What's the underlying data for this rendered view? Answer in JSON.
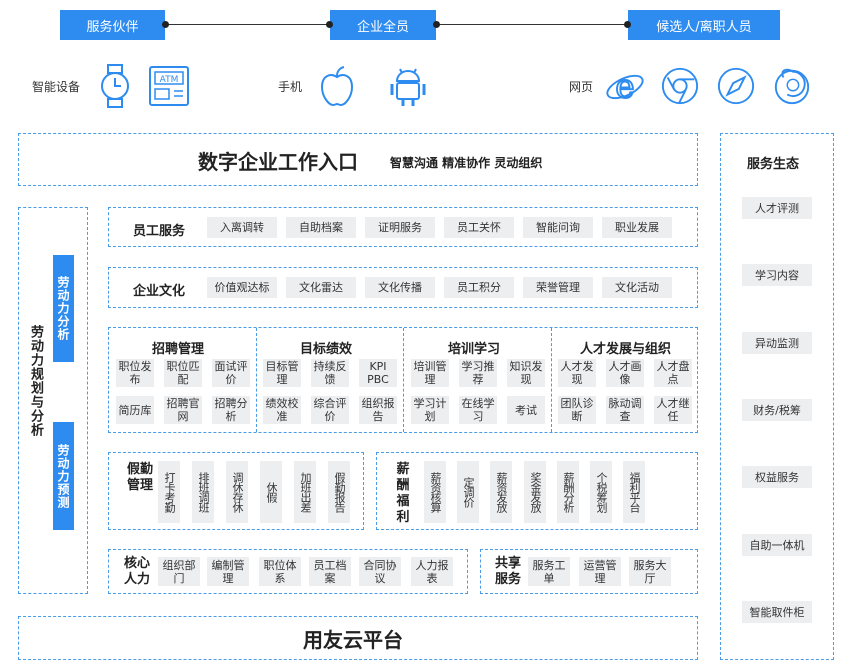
{
  "roles": [
    "服务伙伴",
    "企业全员",
    "候选人/离职人员"
  ],
  "devices": {
    "smart_label": "智能设备",
    "phone_label": "手机",
    "web_label": "网页",
    "atm_text": "ATM"
  },
  "portal": {
    "title": "数字企业工作入口",
    "subtitle": "智慧沟通  精准协作  灵动组织"
  },
  "left_panel": {
    "title": "劳动力规划与分析",
    "bar1": "劳动力分析",
    "bar2": "劳动力预测"
  },
  "employee_service": {
    "title": "员工服务",
    "items": [
      "入离调转",
      "自助档案",
      "证明服务",
      "员工关怀",
      "智能问询",
      "职业发展"
    ]
  },
  "culture": {
    "title": "企业文化",
    "items": [
      "价值观达标",
      "文化雷达",
      "文化传播",
      "员工积分",
      "荣誉管理",
      "文化活动"
    ]
  },
  "modules": [
    {
      "title": "招聘管理",
      "items": [
        "职位发布",
        "职位匹配",
        "面试评价",
        "简历库",
        "招聘官网",
        "招聘分析"
      ]
    },
    {
      "title": "目标绩效",
      "items": [
        "目标管理",
        "持续反馈",
        "KPI PBC",
        "绩效校准",
        "综合评价",
        "组织报告"
      ]
    },
    {
      "title": "培训学习",
      "items": [
        "培训管理",
        "学习推荐",
        "知识发现",
        "学习计划",
        "在线学习",
        "考试"
      ]
    },
    {
      "title": "人才发展与组织",
      "items": [
        "人才发现",
        "人才画像",
        "人才盘点",
        "团队诊断",
        "脉动调查",
        "人才继任"
      ]
    }
  ],
  "attendance": {
    "title": "假勤管理",
    "items": [
      "打卡考勤",
      "排班调班",
      "调休存休",
      "休假",
      "加班出差",
      "假勤报告"
    ]
  },
  "payroll": {
    "title": "薪酬福利",
    "items": [
      "薪资核算",
      "定调价",
      "薪资发放",
      "奖金发放",
      "薪酬分析",
      "个税筹划",
      "福利平台"
    ]
  },
  "core_hr": {
    "title": "核心人力",
    "items": [
      "组织部门",
      "编制管理",
      "职位体系",
      "员工档案",
      "合同协议",
      "人力报表"
    ]
  },
  "shared": {
    "title": "共享服务",
    "items": [
      "服务工单",
      "运营管理",
      "服务大厅"
    ]
  },
  "platform": {
    "title": "用友云平台"
  },
  "ecosystem": {
    "title": "服务生态",
    "items": [
      "人才评测",
      "学习内容",
      "异动监测",
      "财务/税筹",
      "权益服务",
      "自助一体机",
      "智能取件柜"
    ]
  },
  "colors": {
    "accent": "#2e8cf0",
    "dashed": "#4a9be8",
    "chip": "#eceef0"
  }
}
